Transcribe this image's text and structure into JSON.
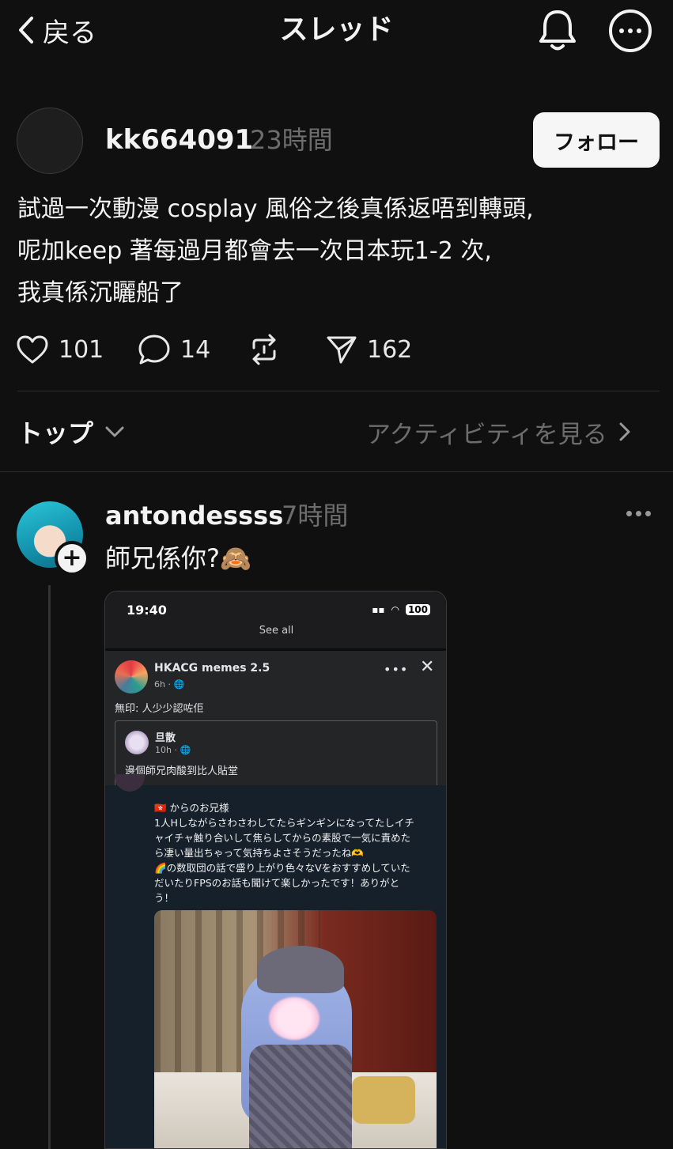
{
  "header": {
    "back_label": "戻る",
    "title": "スレッド"
  },
  "post": {
    "username": "kk664091",
    "time": "23時間",
    "follow_label": "フォロー",
    "body_lines": [
      "試過一次動漫 cosplay 風俗之後真係返唔到轉頭,",
      "呢加keep 著每過月都會去一次日本玩1-2 次,",
      "我真係沉矖船了"
    ],
    "likes": "101",
    "comments": "14",
    "shares": "162"
  },
  "sort": {
    "label": "トップ",
    "activity_label": "アクティビティを見る"
  },
  "reply": {
    "username": "antondessss",
    "time": "7時間",
    "text": "師兄係你?🙈",
    "screenshot": {
      "status_time": "19:40",
      "battery": "100",
      "see_all": "See all",
      "group_name": "HKACG memes 2.5",
      "group_meta": "6h · 🌐",
      "caption": "無印: 人少少認咗佢",
      "inner_name": "旦散",
      "inner_meta": "10h · 🌐",
      "inner_text": "邊個師兄肉酸到比人貼堂",
      "tweet_lines": [
        "🇭🇰 からのお兄様",
        "1人Hしながらさわさわしてたらギンギンになってたしイチ",
        "ャイチャ触り合いして焦らしてからの素股で一気に責めた",
        "ら凄い量出ちゃって気持ちよさそうだったね🫶",
        "🌈の数取団の話で盛り上がり色々なVをおすすめしていた",
        "だいたりFPSのお話も聞けて楽しかったです！ありがと",
        "う！"
      ]
    }
  },
  "icons": {
    "back": "chevron-left-icon",
    "notify": "bell-icon",
    "menu": "more-icon",
    "like": "heart-icon",
    "comment": "comment-icon",
    "repost": "repost-icon",
    "share": "send-icon"
  }
}
